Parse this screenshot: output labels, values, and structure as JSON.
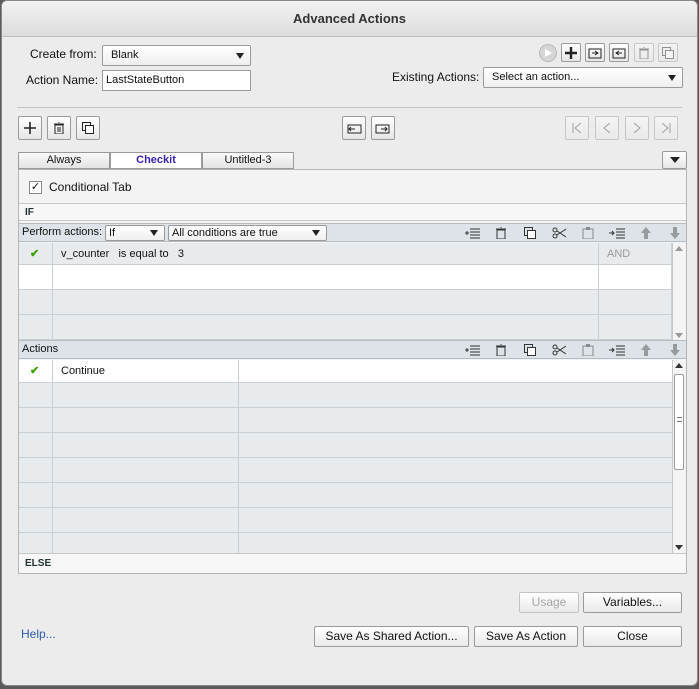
{
  "window": {
    "title": "Advanced Actions"
  },
  "header": {
    "create_from_label": "Create from:",
    "create_from_value": "Blank",
    "action_name_label": "Action Name:",
    "action_name_value": "LastStateButton",
    "existing_actions_label": "Existing Actions:",
    "existing_actions_placeholder": "Select an action..."
  },
  "tabs": [
    {
      "label": "Always"
    },
    {
      "label": "Checkit"
    },
    {
      "label": "Untitled-3"
    }
  ],
  "conditional": {
    "checked": true,
    "label": "Conditional Tab"
  },
  "if_section": {
    "heading": "IF",
    "perform_label": "Perform actions:",
    "perform_value": "If",
    "condition_mode": "All conditions are true",
    "rows": [
      {
        "checked": true,
        "variable": "v_counter",
        "operator": "is equal to",
        "value": "3",
        "logic": "AND"
      }
    ]
  },
  "actions_section": {
    "heading": "Actions",
    "rows": [
      {
        "checked": true,
        "action": "Continue"
      }
    ]
  },
  "else_section": {
    "heading": "ELSE"
  },
  "footer": {
    "usage": "Usage",
    "variables": "Variables...",
    "help": "Help...",
    "save_shared": "Save As Shared Action...",
    "save_as_action": "Save As Action",
    "close": "Close"
  },
  "colors": {
    "active_tab": "#3a1fb0",
    "check": "#3aa000",
    "link": "#2a5caa"
  }
}
